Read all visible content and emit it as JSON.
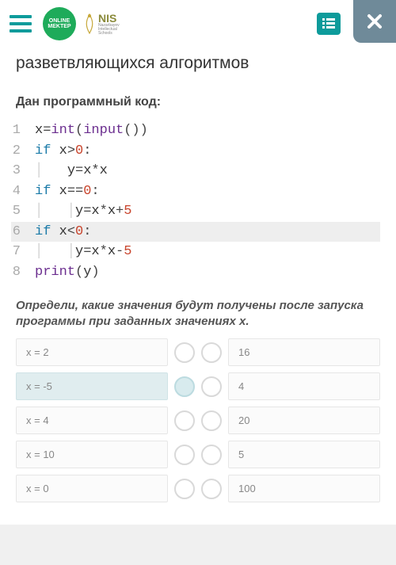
{
  "header": {
    "online_logo_line1": "ONLINE",
    "online_logo_line2": "MEKTEP",
    "nis_big": "NIS",
    "nis_small1": "Nazarbayev",
    "nis_small2": "Intellectual",
    "nis_small3": "Schools"
  },
  "title": "разветвляющихся алгоритмов",
  "code_prompt": "Дан программный код:",
  "code": {
    "l1": "x=int(input())",
    "l2": "if x>0:",
    "l3": "y=x*x",
    "l4": "if x==0:",
    "l5": "y=x*x+5",
    "l6": "if x<0:",
    "l7": "y=x*x-5",
    "l8": "print(y)"
  },
  "question": "Определи, какие значения будут получены после запуска программы при заданных значениях x.",
  "pairs": {
    "left": [
      "x = 2",
      "x = -5",
      "x = 4",
      "x = 10",
      "x = 0"
    ],
    "right": [
      "16",
      "4",
      "20",
      "5",
      "100"
    ],
    "active_index": 1
  }
}
